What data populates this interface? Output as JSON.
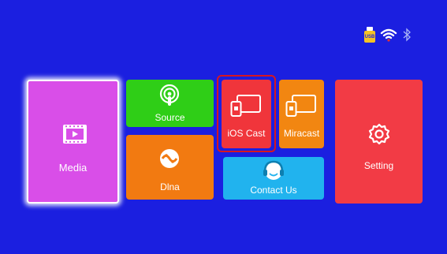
{
  "status_bar": {
    "usb_label": "USB",
    "icons": [
      "usb-icon",
      "wifi-icon",
      "bluetooth-icon"
    ]
  },
  "tiles": {
    "media": {
      "label": "Media",
      "color": "#d94ee8",
      "selected": true
    },
    "source": {
      "label": "Source",
      "color": "#2fce17"
    },
    "dlna": {
      "label": "Dlna",
      "color": "#f27a11"
    },
    "ios_cast": {
      "label": "iOS Cast",
      "color": "#f0353b",
      "focused": true,
      "focus_color": "#d8161e"
    },
    "miracast": {
      "label": "Miracast",
      "color": "#f28611"
    },
    "contact_us": {
      "label": "Contact Us",
      "color": "#21b3ee"
    },
    "setting": {
      "label": "Setting",
      "color": "#f23b45"
    }
  },
  "colors": {
    "background": "#1b1fe0",
    "selected_glow": "#ffffff"
  }
}
